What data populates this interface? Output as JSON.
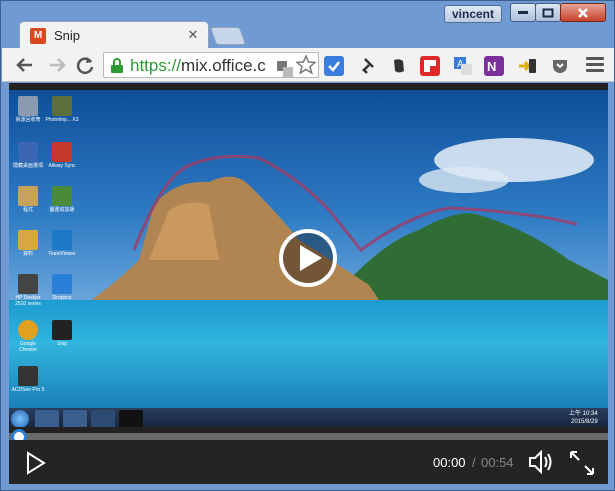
{
  "titlebar": {
    "user": "vincent"
  },
  "tab": {
    "title": "Snip",
    "favicon_text": "M"
  },
  "omnibox": {
    "scheme": "https://",
    "host": "mix.office.c"
  },
  "desktop_icons": [
    {
      "label": "資源回收筒",
      "color": "#8a9bb0"
    },
    {
      "label": "PhotoImp... X3",
      "color": "#5c6f3a"
    },
    {
      "label": "隱藏桌面選項",
      "color": "#3a66b3"
    },
    {
      "label": "Allway Sync",
      "color": "#c33a2a"
    },
    {
      "label": "程式",
      "color": "#c8a25a"
    },
    {
      "label": "圖書追加版",
      "color": "#4a8a3a"
    },
    {
      "label": "資料",
      "color": "#d8a840"
    },
    {
      "label": "TeamViewer",
      "color": "#1c78c8"
    },
    {
      "label": "HP Deskjet 2510 series",
      "color": "#444444"
    },
    {
      "label": "Dropbox",
      "color": "#2a7fd8"
    },
    {
      "label": "Google Chrome",
      "color": "#e0a020"
    },
    {
      "label": "Snip",
      "color": "#222222"
    },
    {
      "label": "ACDSee Pro 5",
      "color": "#333333"
    }
  ],
  "tray": {
    "time": "上午 10:34",
    "date": "2015/8/29"
  },
  "player": {
    "current_time": "00:00",
    "separator": "/",
    "duration": "00:54",
    "progress": 0
  }
}
